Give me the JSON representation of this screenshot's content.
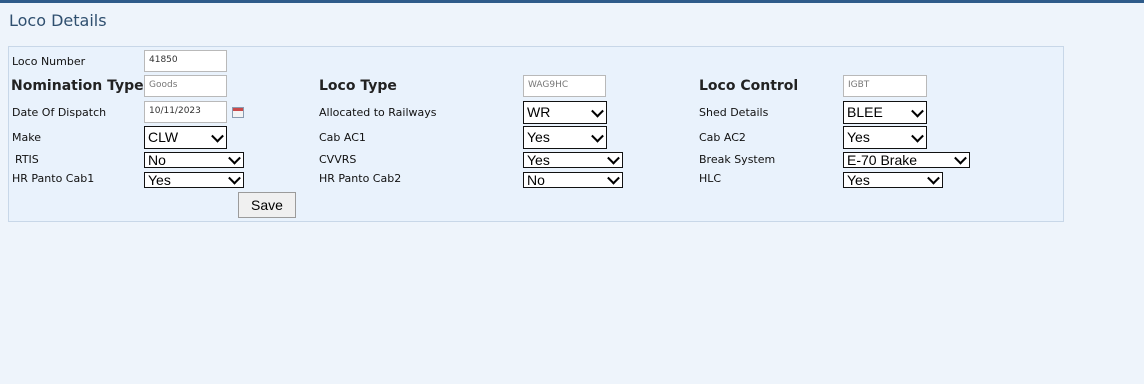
{
  "page": {
    "title": "Loco Details"
  },
  "form": {
    "loco_number": {
      "label": "Loco Number",
      "value": "41850"
    },
    "nomination_type": {
      "label": "Nomination Type",
      "value": "Goods"
    },
    "loco_type": {
      "label": "Loco Type",
      "value": "WAG9HC"
    },
    "loco_control": {
      "label": "Loco Control",
      "value": "IGBT"
    },
    "date_of_dispatch": {
      "label": "Date Of Dispatch",
      "value": "10/11/2023"
    },
    "allocated_to_railways": {
      "label": "Allocated to Railways",
      "value": "WR"
    },
    "shed_details": {
      "label": "Shed Details",
      "value": "BLEE"
    },
    "make": {
      "label": "Make",
      "value": "CLW"
    },
    "cab_ac1": {
      "label": "Cab AC1",
      "value": "Yes"
    },
    "cab_ac2": {
      "label": "Cab AC2",
      "value": "Yes"
    },
    "rtis": {
      "label": "RTIS",
      "value": "No"
    },
    "cvvrs": {
      "label": "CVVRS",
      "value": "Yes"
    },
    "break_system": {
      "label": "Break System",
      "value": "E-70 Brake"
    },
    "hr_panto_cab1": {
      "label": "HR Panto Cab1",
      "value": "Yes"
    },
    "hr_panto_cab2": {
      "label": "HR Panto Cab2",
      "value": "No"
    },
    "hlc": {
      "label": "HLC",
      "value": "Yes"
    },
    "save_label": "Save"
  }
}
